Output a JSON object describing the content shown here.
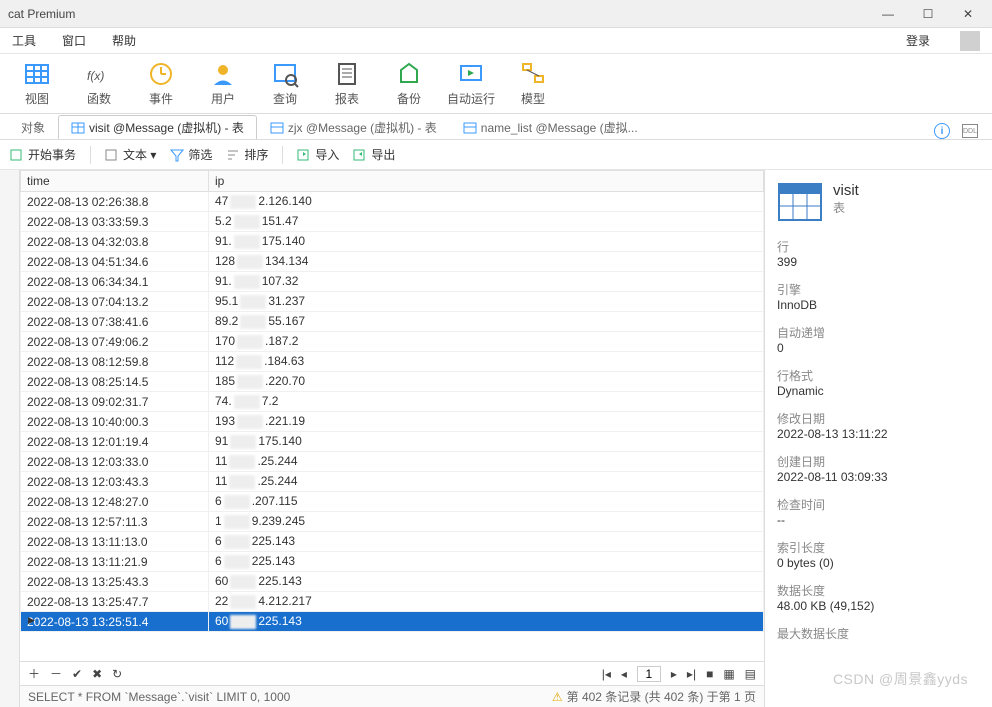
{
  "window": {
    "title": "cat Premium"
  },
  "menu": {
    "tools": "工具",
    "window": "窗口",
    "help": "帮助",
    "login": "登录"
  },
  "toolbar": [
    {
      "label": "视图"
    },
    {
      "label": "函数"
    },
    {
      "label": "事件"
    },
    {
      "label": "用户"
    },
    {
      "label": "查询"
    },
    {
      "label": "报表"
    },
    {
      "label": "备份"
    },
    {
      "label": "自动运行"
    },
    {
      "label": "模型"
    }
  ],
  "tabs": {
    "items": [
      {
        "label": "对象",
        "active": false
      },
      {
        "label": "visit @Message (虚拟机) - 表",
        "active": true
      },
      {
        "label": "zjx @Message (虚拟机) - 表",
        "active": false
      },
      {
        "label": "name_list @Message (虚拟...",
        "active": false
      }
    ]
  },
  "subtoolbar": {
    "begin": "开始事务",
    "text": "文本 ▾",
    "filter": "筛选",
    "sort": "排序",
    "import": "导入",
    "export": "导出"
  },
  "grid": {
    "columns": [
      "time",
      "ip"
    ],
    "rows": [
      {
        "time": "2022-08-13 02:26:38.8",
        "ip_a": "47",
        "ip_b": "2.126.140"
      },
      {
        "time": "2022-08-13 03:33:59.3",
        "ip_a": "5.2",
        "ip_b": "151.47"
      },
      {
        "time": "2022-08-13 04:32:03.8",
        "ip_a": "91.",
        "ip_b": "175.140"
      },
      {
        "time": "2022-08-13 04:51:34.6",
        "ip_a": "128",
        "ip_b": "134.134"
      },
      {
        "time": "2022-08-13 06:34:34.1",
        "ip_a": "91.",
        "ip_b": "107.32"
      },
      {
        "time": "2022-08-13 07:04:13.2",
        "ip_a": "95.1",
        "ip_b": "31.237"
      },
      {
        "time": "2022-08-13 07:38:41.6",
        "ip_a": "89.2",
        "ip_b": "55.167"
      },
      {
        "time": "2022-08-13 07:49:06.2",
        "ip_a": "170",
        "ip_b": ".187.2"
      },
      {
        "time": "2022-08-13 08:12:59.8",
        "ip_a": "112",
        "ip_b": ".184.63"
      },
      {
        "time": "2022-08-13 08:25:14.5",
        "ip_a": "185",
        "ip_b": ".220.70"
      },
      {
        "time": "2022-08-13 09:02:31.7",
        "ip_a": "74.",
        "ip_b": "7.2"
      },
      {
        "time": "2022-08-13 10:40:00.3",
        "ip_a": "193",
        "ip_b": ".221.19"
      },
      {
        "time": "2022-08-13 12:01:19.4",
        "ip_a": "91",
        "ip_b": "175.140"
      },
      {
        "time": "2022-08-13 12:03:33.0",
        "ip_a": "11",
        "ip_b": ".25.244"
      },
      {
        "time": "2022-08-13 12:03:43.3",
        "ip_a": "11",
        "ip_b": ".25.244"
      },
      {
        "time": "2022-08-13 12:48:27.0",
        "ip_a": "6",
        "ip_b": ".207.115"
      },
      {
        "time": "2022-08-13 12:57:11.3",
        "ip_a": "1",
        "ip_b": "9.239.245"
      },
      {
        "time": "2022-08-13 13:11:13.0",
        "ip_a": "6",
        "ip_b": "225.143"
      },
      {
        "time": "2022-08-13 13:11:21.9",
        "ip_a": "6",
        "ip_b": "225.143"
      },
      {
        "time": "2022-08-13 13:25:43.3",
        "ip_a": "60",
        "ip_b": "225.143"
      },
      {
        "time": "2022-08-13 13:25:47.7",
        "ip_a": "22",
        "ip_b": "4.212.217"
      },
      {
        "time": "2022-08-13 13:25:51.4",
        "ip_a": "60",
        "ip_b": "225.143",
        "selected": true
      }
    ],
    "page_input": "1"
  },
  "status": {
    "sql": "SELECT * FROM `Message`.`visit` LIMIT 0, 1000",
    "info": "第 402 条记录 (共 402 条) 于第 1 页"
  },
  "side": {
    "title": "visit",
    "subtitle": "表",
    "rows_label": "行",
    "rows_val": "399",
    "engine_label": "引擎",
    "engine_val": "InnoDB",
    "autoinc_label": "自动递增",
    "autoinc_val": "0",
    "format_label": "行格式",
    "format_val": "Dynamic",
    "modified_label": "修改日期",
    "modified_val": "2022-08-13 13:11:22",
    "created_label": "创建日期",
    "created_val": "2022-08-11 03:09:33",
    "check_label": "检查时间",
    "check_val": "--",
    "index_label": "索引长度",
    "index_val": "0 bytes (0)",
    "datalen_label": "数据长度",
    "datalen_val": "48.00 KB (49,152)",
    "maxlen_label": "最大数据长度"
  },
  "watermark": "CSDN @周景鑫yyds"
}
